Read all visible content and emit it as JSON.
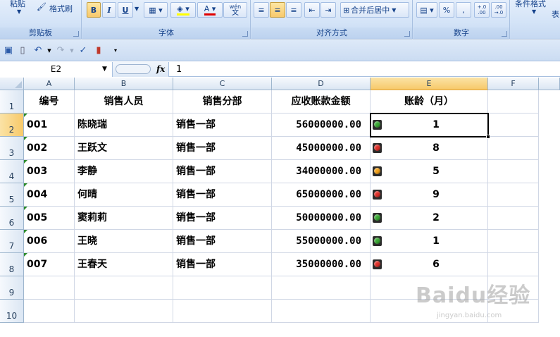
{
  "ribbon": {
    "clipboard": {
      "label": "剪贴板",
      "paste_label": "粘贴",
      "format_painter_label": "格式刷"
    },
    "font": {
      "label": "字体",
      "bold": "B",
      "italic": "I",
      "underline": "U",
      "wen": "wén",
      "wen_char": "文"
    },
    "alignment": {
      "label": "对齐方式",
      "merge_center_label": "合并后居中"
    },
    "number": {
      "label": "数字",
      "percent": "%",
      "comma": ",",
      "inc_decimal": "+.0 .00",
      "dec_decimal": ".00 →.0"
    },
    "styles": {
      "conditional_format_label": "条件格式",
      "table_label_fragment": "表"
    }
  },
  "formula_bar": {
    "name_box": "E2",
    "fx": "fx",
    "content": "1"
  },
  "columns": [
    {
      "letter": "A",
      "selected": false
    },
    {
      "letter": "B",
      "selected": false
    },
    {
      "letter": "C",
      "selected": false
    },
    {
      "letter": "D",
      "selected": false
    },
    {
      "letter": "E",
      "selected": true
    },
    {
      "letter": "F",
      "selected": false
    }
  ],
  "rows": [
    "1",
    "2",
    "3",
    "4",
    "5",
    "6",
    "7",
    "8",
    "9",
    "10"
  ],
  "headers": [
    "编号",
    "销售人员",
    "销售分部",
    "应收账款金额",
    "账龄（月）"
  ],
  "records": [
    {
      "id": "001",
      "name": "陈晓瑞",
      "dept": "销售一部",
      "amount": "56000000.00",
      "age": "1",
      "light": "green"
    },
    {
      "id": "002",
      "name": "王跃文",
      "dept": "销售一部",
      "amount": "45000000.00",
      "age": "8",
      "light": "red"
    },
    {
      "id": "003",
      "name": "李静",
      "dept": "销售一部",
      "amount": "34000000.00",
      "age": "5",
      "light": "yellow"
    },
    {
      "id": "004",
      "name": "何晴",
      "dept": "销售一部",
      "amount": "65000000.00",
      "age": "9",
      "light": "red"
    },
    {
      "id": "005",
      "name": "窦莉莉",
      "dept": "销售一部",
      "amount": "50000000.00",
      "age": "2",
      "light": "green"
    },
    {
      "id": "006",
      "name": "王晓",
      "dept": "销售一部",
      "amount": "55000000.00",
      "age": "1",
      "light": "green"
    },
    {
      "id": "007",
      "name": "王春天",
      "dept": "销售一部",
      "amount": "35000000.00",
      "age": "6",
      "light": "red"
    }
  ],
  "light_colors": {
    "green": "#3aa935",
    "red": "#e0302a",
    "yellow": "#f3a21b"
  },
  "accent": {
    "selected_header": "#f7c969",
    "grid_line": "#d0d7e5"
  },
  "watermark": {
    "main": "Baidu经验",
    "sub": "jingyan.baidu.com"
  }
}
